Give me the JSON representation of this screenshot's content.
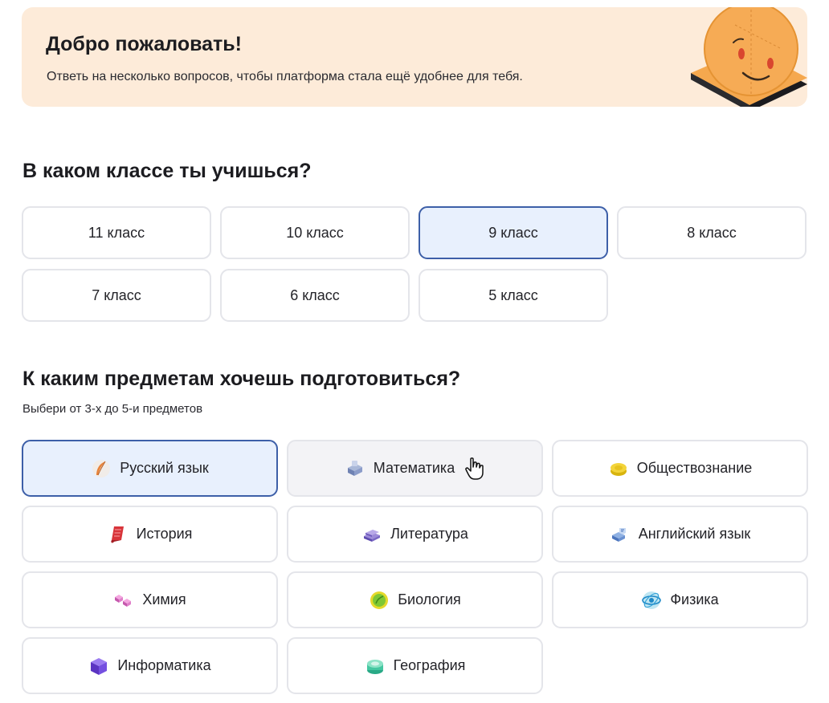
{
  "banner": {
    "title": "Добро пожаловать!",
    "subtitle": "Ответь на несколько вопросов, чтобы платформа стала ещё удобнее для тебя."
  },
  "grade_section": {
    "title": "В каком классе ты учишься?",
    "options": [
      "11 класс",
      "10 класс",
      "9 класс",
      "8 класс",
      "7 класс",
      "6 класс",
      "5 класс"
    ],
    "selected": "9 класс"
  },
  "subject_section": {
    "title": "К каким предметам хочешь подготовиться?",
    "hint": "Выбери от 3-х до 5-и предметов",
    "options": [
      {
        "label": "Русский язык",
        "icon": "quill-icon"
      },
      {
        "label": "Математика",
        "icon": "calculator-icon"
      },
      {
        "label": "Обществознание",
        "icon": "coin-icon"
      },
      {
        "label": "История",
        "icon": "scroll-icon"
      },
      {
        "label": "Литература",
        "icon": "books-icon"
      },
      {
        "label": "Английский язык",
        "icon": "letters-icon"
      },
      {
        "label": "Химия",
        "icon": "molecule-icon"
      },
      {
        "label": "Биология",
        "icon": "leaf-icon"
      },
      {
        "label": "Физика",
        "icon": "atom-icon"
      },
      {
        "label": "Информатика",
        "icon": "cube-icon"
      },
      {
        "label": "География",
        "icon": "globe-icon"
      }
    ],
    "selected": "Русский язык",
    "hovered": "Математика"
  },
  "colors": {
    "banner_bg": "#fdebd9",
    "selected_bg": "#e8f0fd",
    "selected_border": "#3d5fa8",
    "hover_bg": "#f3f3f6",
    "mascot": "#f5a84e"
  }
}
